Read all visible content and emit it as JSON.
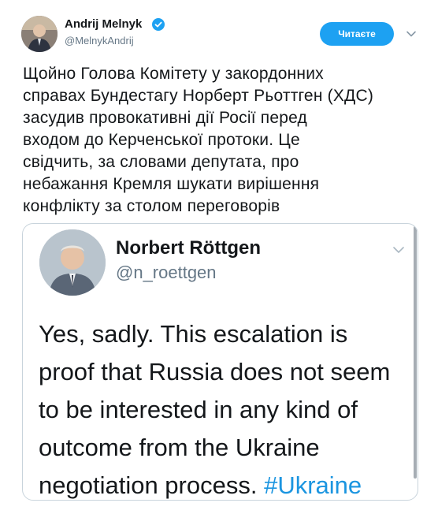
{
  "tweet": {
    "author_name": "Andrij Melnyk",
    "author_handle": "@MelnykAndrij",
    "follow_label": "Читаєте",
    "text": "Щойно Голова Комітету у закордонних\nсправах Бундестагу Норберт Рьоттген (ХДС)\nзасудив провокативні дії Росії перед\nвходом до Керченської протоки. Це\nсвідчить, за словами депутата, про\nнебажання Кремля шукати вирішення\nконфлікту за столом переговорів"
  },
  "quoted": {
    "author_name": "Norbert Röttgen",
    "author_handle": "@n_roettgen",
    "text": "Yes, sadly. This escalation is proof that Russia does not seem to be interested in any kind of outcome from the Ukraine negotiation process.",
    "hashtag": "#Ukraine"
  },
  "icons": {
    "verified": "verified-badge-icon",
    "caret": "chevron-down-icon"
  },
  "colors": {
    "accent": "#1da1f2",
    "link": "#1b95e0",
    "secondary_text": "#657786",
    "card_border": "#c9d4dc"
  }
}
